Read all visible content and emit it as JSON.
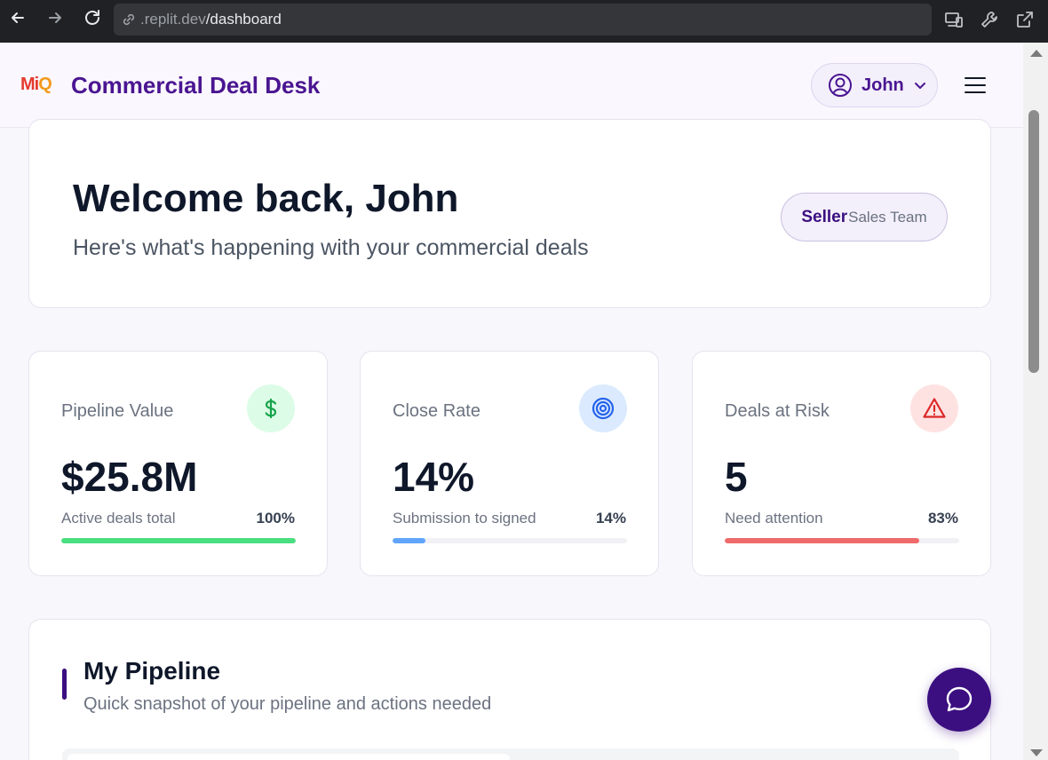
{
  "browser": {
    "url_prefix": ".replit.dev",
    "url_path": "/dashboard"
  },
  "header": {
    "logo_part1": "Mi",
    "logo_part2": "Q",
    "title": "Commercial Deal Desk",
    "user_name": "John"
  },
  "welcome": {
    "heading": "Welcome back, John",
    "subheading": "Here's what's happening with your commercial deals",
    "role": "Seller",
    "team": "Sales Team"
  },
  "stats": [
    {
      "label": "Pipeline Value",
      "value": "$25.8M",
      "sub": "Active deals total",
      "pct_label": "100%",
      "progress": 1.0,
      "icon": "dollar-icon",
      "icon_bg": "#dcfce7",
      "icon_color": "#16a34a",
      "bar_color": "#4ade80"
    },
    {
      "label": "Close Rate",
      "value": "14%",
      "sub": "Submission to signed",
      "pct_label": "14%",
      "progress": 0.14,
      "icon": "target-icon",
      "icon_bg": "#dbeafe",
      "icon_color": "#2563eb",
      "bar_color": "#60a5fa"
    },
    {
      "label": "Deals at Risk",
      "value": "5",
      "sub": "Need attention",
      "pct_label": "83%",
      "progress": 0.83,
      "icon": "warning-icon",
      "icon_bg": "#fee2e2",
      "icon_color": "#dc2626",
      "bar_color": "#ef6b6b"
    }
  ],
  "pipeline": {
    "title": "My Pipeline",
    "subtitle": "Quick snapshot of your pipeline and actions needed"
  },
  "colors": {
    "brand": "#4a1591",
    "brand_dark": "#3b0f80"
  }
}
